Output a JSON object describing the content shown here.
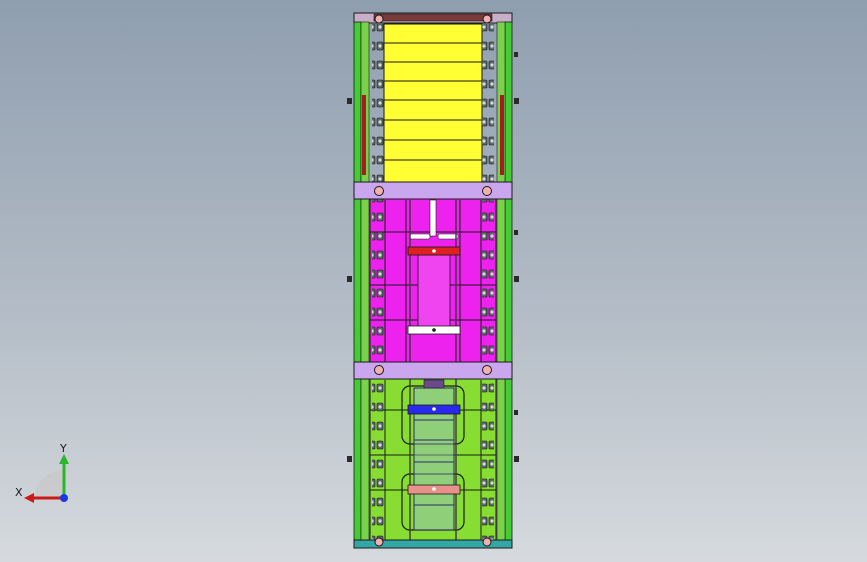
{
  "viewport": {
    "background_top": "#8f9eaf",
    "background_bottom": "#d6dade"
  },
  "model": {
    "colors": {
      "top_frame": "#c8aec8",
      "yellow_section": "#ffff33",
      "magenta_section": "#ee22ee",
      "green_section": "#88dd33",
      "crossbar": "#c9a6ee",
      "red_plate": "#e02020",
      "white_plate": "#ffffff",
      "blue_plate": "#2a2aee",
      "salmon_plate": "#e8908a",
      "bottom_bar": "#33a6a6",
      "rail_green": "#44cc33",
      "outline": "#1a1a1a"
    }
  },
  "triad": {
    "x_label": "X",
    "y_label": "Y",
    "icon": "coordinate-triad-icon"
  }
}
